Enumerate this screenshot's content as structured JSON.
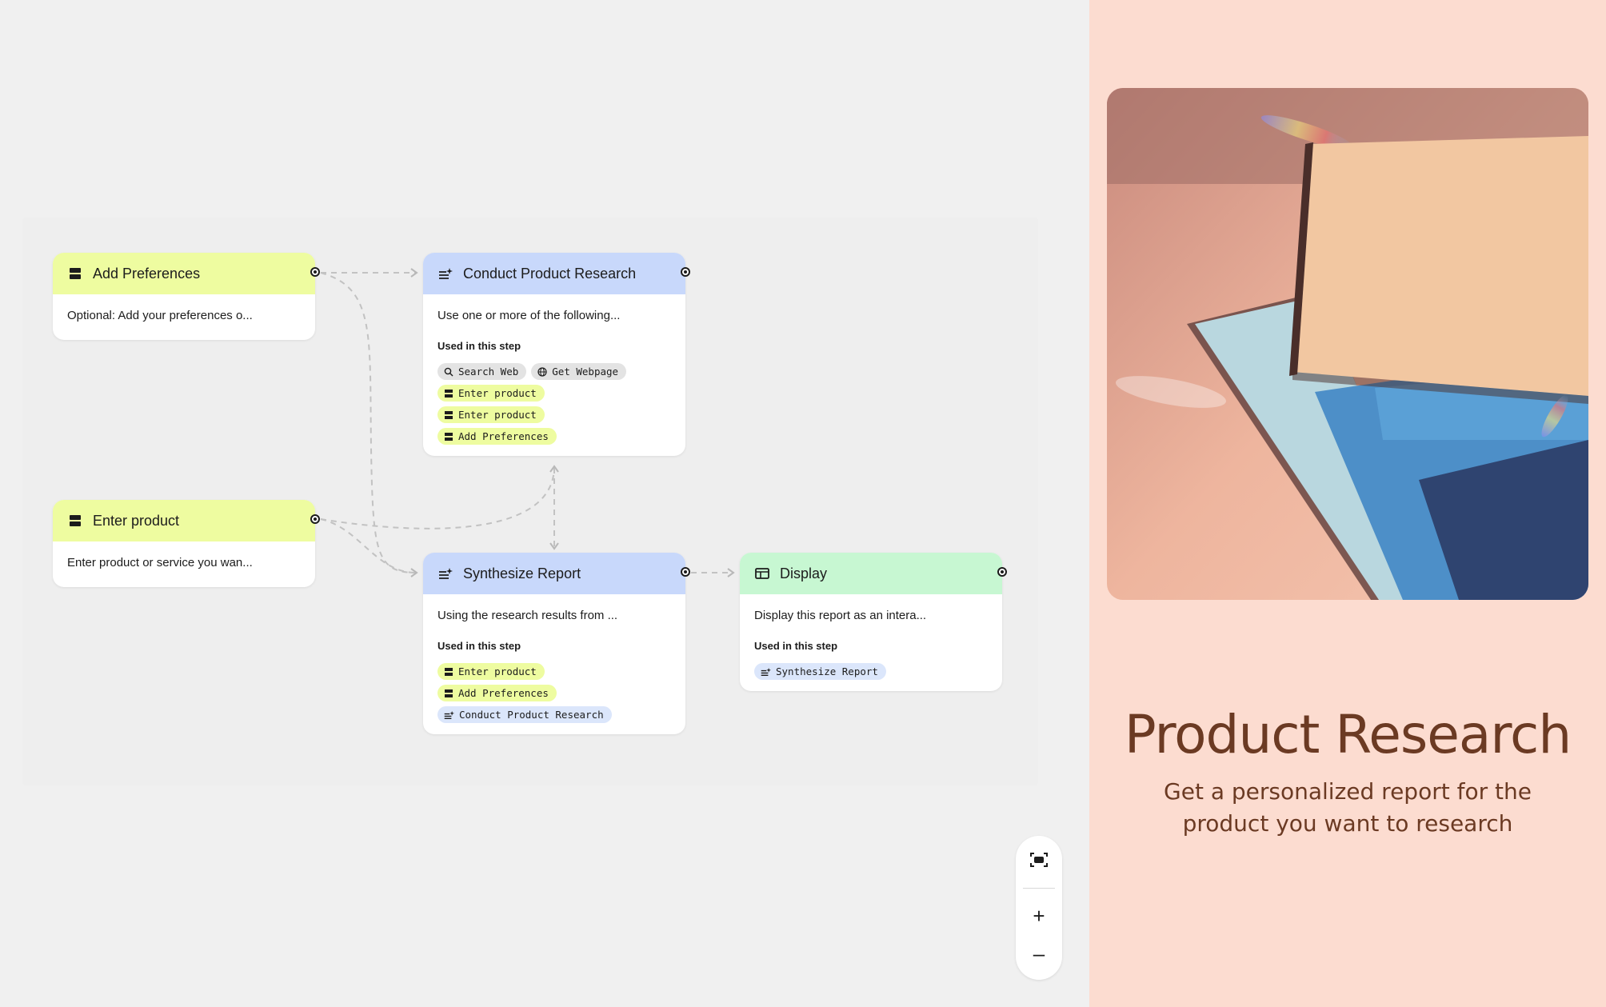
{
  "nodes": {
    "add_preferences": {
      "title": "Add Preferences",
      "description": "Optional: Add your preferences o..."
    },
    "enter_product": {
      "title": "Enter product",
      "description": "Enter product or service you wan..."
    },
    "conduct_research": {
      "title": "Conduct Product Research",
      "description": "Use one or more of the following...",
      "used_label": "Used in this step",
      "chips": [
        "Search Web",
        "Get Webpage",
        "Enter product",
        "Enter product",
        "Add Preferences"
      ]
    },
    "synthesize_report": {
      "title": "Synthesize Report",
      "description": "Using the research results from ...",
      "used_label": "Used in this step",
      "chips": [
        "Enter product",
        "Add Preferences",
        "Conduct Product Research"
      ]
    },
    "display": {
      "title": "Display",
      "description": "Display this report as an intera...",
      "used_label": "Used in this step",
      "chips": [
        "Synthesize Report"
      ]
    }
  },
  "icons": {
    "input": "input-field-icon",
    "generate": "sparkle-list-icon",
    "display": "display-window-icon",
    "search": "search-icon",
    "globe": "globe-icon",
    "fit": "fit-to-screen-icon",
    "zoom_in": "plus-icon",
    "zoom_out": "minus-icon"
  },
  "zoom_controls": {
    "zoom_in": "+",
    "zoom_out": "–"
  },
  "panel": {
    "title": "Product Research",
    "subtitle": "Get a personalized report for the product you want to research"
  },
  "colors": {
    "input_node": "#eefca0",
    "generate_node": "#c8d8fb",
    "display_node": "#c7f7d2",
    "panel_bg": "#fcdcd0",
    "panel_text": "#6b3a23"
  }
}
